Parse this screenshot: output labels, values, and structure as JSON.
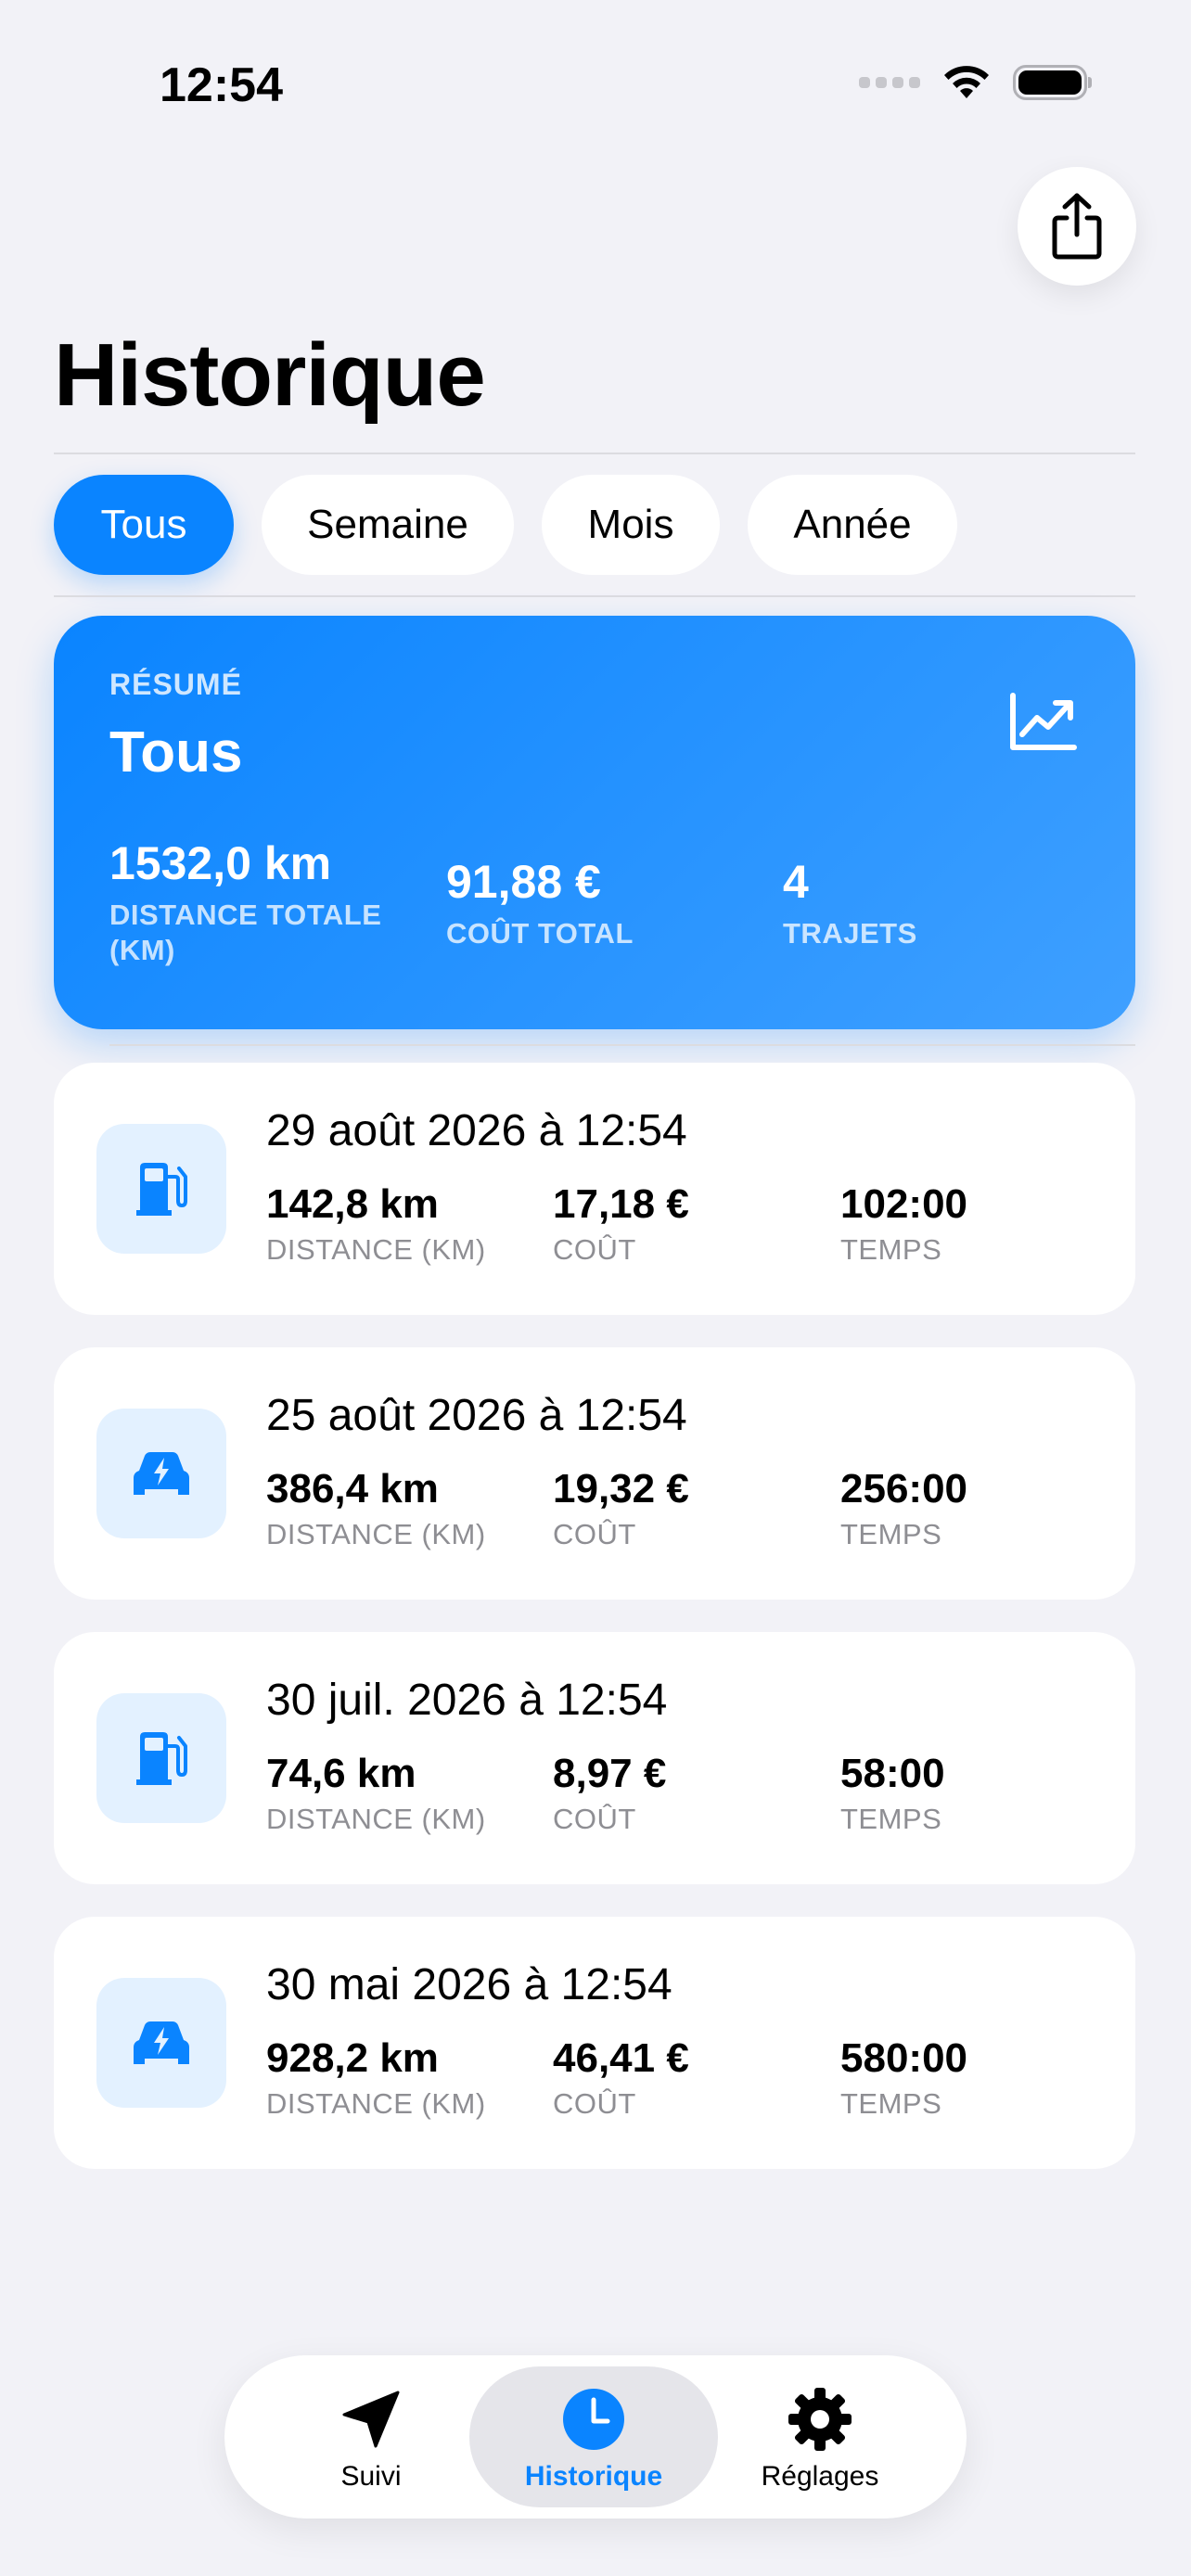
{
  "status_bar": {
    "time": "12:54"
  },
  "header": {
    "title": "Historique",
    "share_icon": "share-icon"
  },
  "filters": [
    {
      "label": "Tous",
      "active": true
    },
    {
      "label": "Semaine",
      "active": false
    },
    {
      "label": "Mois",
      "active": false
    },
    {
      "label": "Année",
      "active": false
    }
  ],
  "summary": {
    "kicker": "RÉSUMÉ",
    "title": "Tous",
    "icon": "chart-line-icon",
    "stats": [
      {
        "value": "1532,0 km",
        "label_line1": "DISTANCE TOTALE",
        "label_line2": "(KM)"
      },
      {
        "value": "91,88 €",
        "label_line1": "COÛT TOTAL",
        "label_line2": ""
      },
      {
        "value": "4",
        "label_line1": "TRAJETS",
        "label_line2": ""
      }
    ]
  },
  "trips": [
    {
      "type": "fuel",
      "icon": "fuel-pump-icon",
      "date": "29 août 2026 à 12:54",
      "distance": "142,8 km",
      "distance_label": "DISTANCE (KM)",
      "cost": "17,18 €",
      "cost_label": "COÛT",
      "time": "102:00",
      "time_label": "TEMPS"
    },
    {
      "type": "electric",
      "icon": "electric-car-icon",
      "date": "25 août 2026 à 12:54",
      "distance": "386,4 km",
      "distance_label": "DISTANCE (KM)",
      "cost": "19,32 €",
      "cost_label": "COÛT",
      "time": "256:00",
      "time_label": "TEMPS"
    },
    {
      "type": "fuel",
      "icon": "fuel-pump-icon",
      "date": "30 juil. 2026 à 12:54",
      "distance": "74,6 km",
      "distance_label": "DISTANCE (KM)",
      "cost": "8,97 €",
      "cost_label": "COÛT",
      "time": "58:00",
      "time_label": "TEMPS"
    },
    {
      "type": "electric",
      "icon": "electric-car-icon",
      "date": "30 mai 2026 à 12:54",
      "distance": "928,2 km",
      "distance_label": "DISTANCE (KM)",
      "cost": "46,41 €",
      "cost_label": "COÛT",
      "time": "580:00",
      "time_label": "TEMPS"
    }
  ],
  "tabbar": {
    "tabs": [
      {
        "label": "Suivi",
        "icon": "location-arrow-icon",
        "active": false
      },
      {
        "label": "Historique",
        "icon": "clock-icon",
        "active": true
      },
      {
        "label": "Réglages",
        "icon": "gear-icon",
        "active": false
      }
    ]
  },
  "colors": {
    "accent": "#0a84ff",
    "background": "#f2f2f7",
    "card": "#ffffff",
    "icon_tile": "#e3f1ff",
    "secondary_text": "#8e8e93"
  }
}
